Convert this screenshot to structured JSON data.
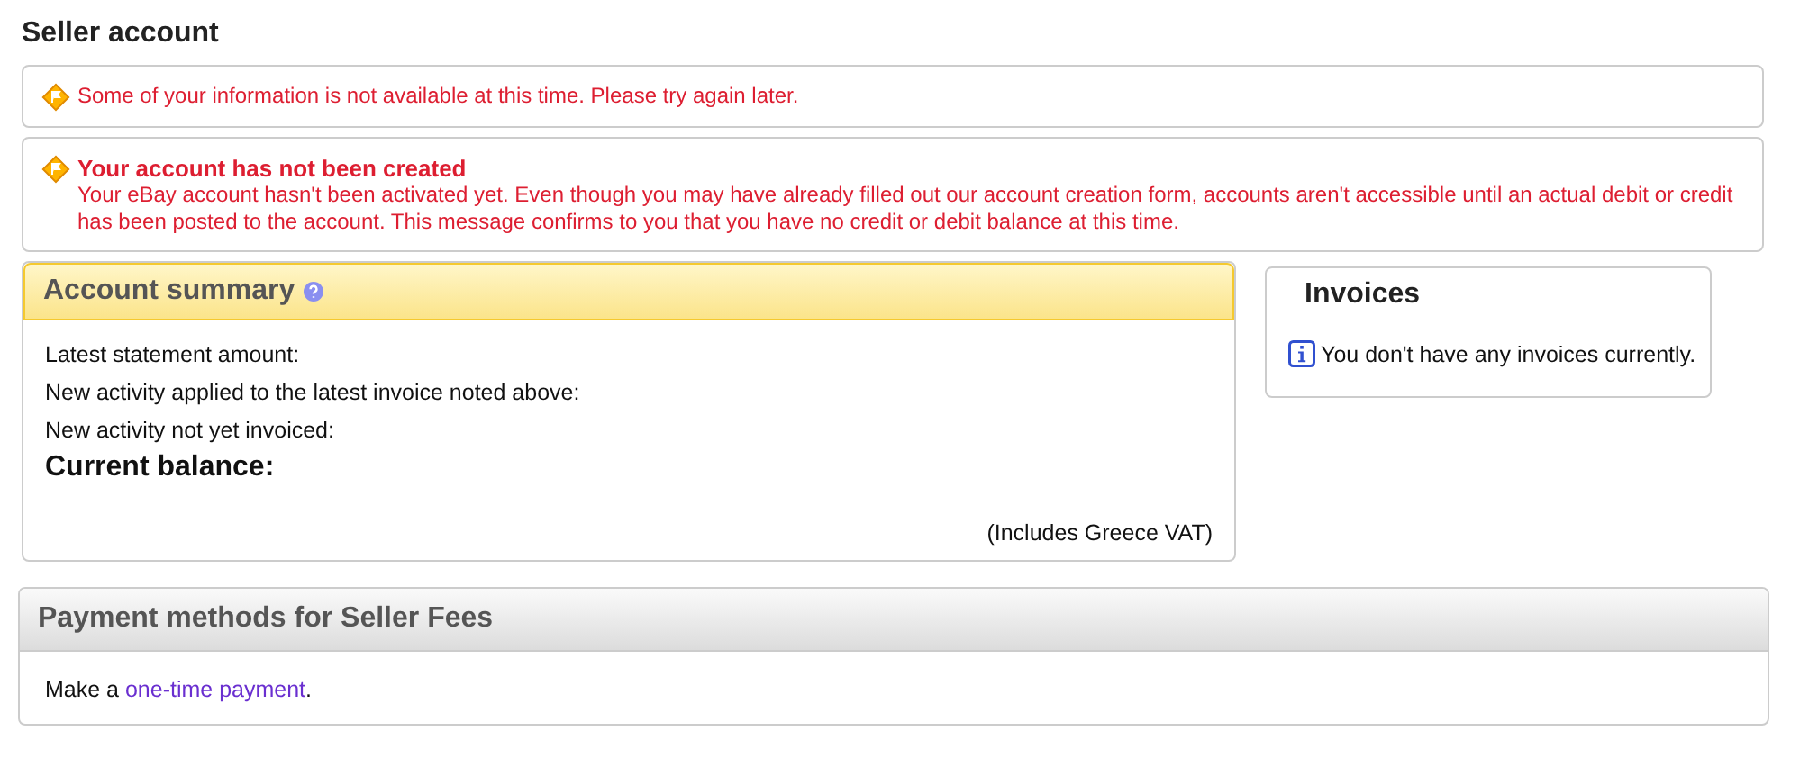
{
  "page_title": "Seller account",
  "alerts": [
    {
      "message": "Some of your information is not available at this time. Please try again later."
    },
    {
      "title": "Your account has not been created",
      "message": "Your eBay account hasn't been activated yet. Even though you may have already filled out our account creation form, accounts aren't accessible until an actual debit or credit has been posted to the account. This message confirms to you that you have no credit or debit balance at this time."
    }
  ],
  "account_summary": {
    "title": "Account summary",
    "lines": [
      "Latest statement amount:",
      "New activity applied to the latest invoice noted above:",
      "New activity not yet invoiced:"
    ],
    "balance_label": "Current balance:",
    "vat_note": "(Includes Greece VAT)"
  },
  "invoices": {
    "title": "Invoices",
    "message": "You don't have any invoices currently."
  },
  "payment_methods": {
    "title": "Payment methods for Seller Fees",
    "text_before": "Make a ",
    "link": "one-time payment",
    "text_after": "."
  }
}
